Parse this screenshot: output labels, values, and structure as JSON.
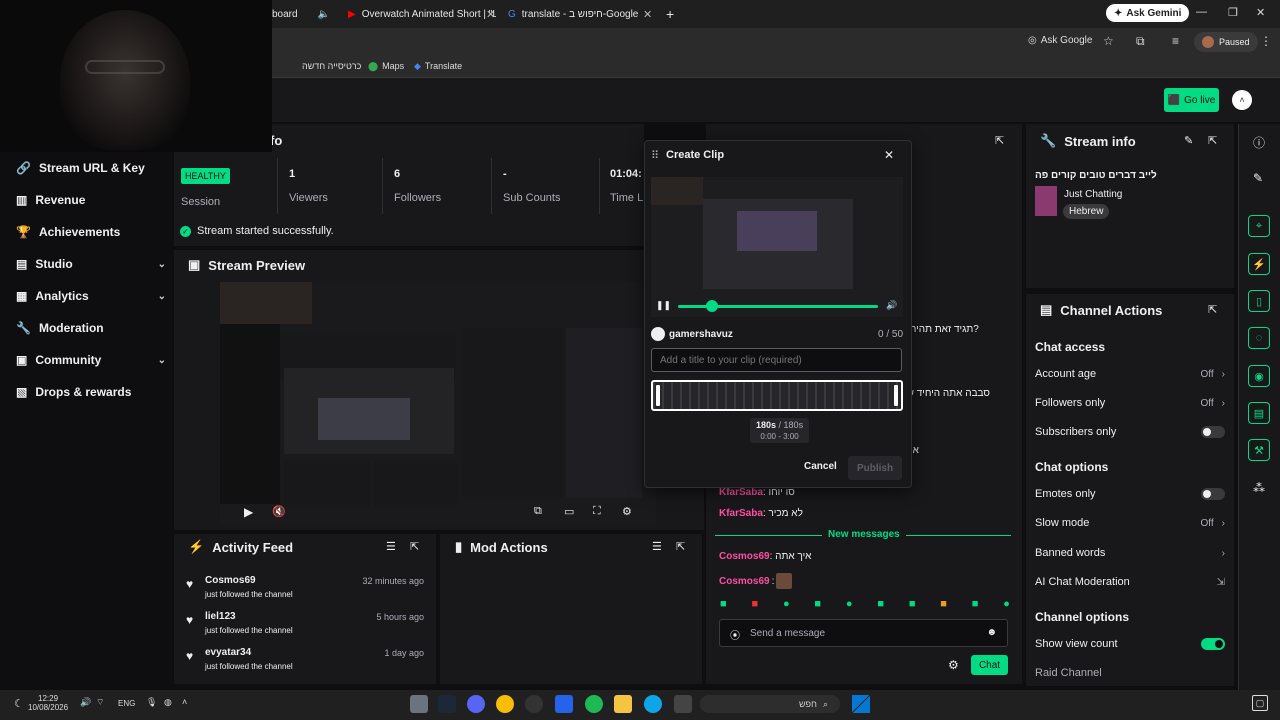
{
  "browser": {
    "tabs": [
      {
        "label": "board"
      },
      {
        "label": "Overwatch Animated Short | \"L"
      },
      {
        "label": "translate - חיפוש ב-Google"
      }
    ],
    "ask_gemini": "Ask Gemini",
    "ask_google": "Ask Google",
    "paused": "Paused",
    "bookmarks": [
      "כרטיסייה חדשה",
      "Maps",
      "Translate"
    ]
  },
  "topnav": {
    "go_live": "Go live"
  },
  "sidebar": {
    "items": [
      {
        "label": "Stream URL & Key",
        "icon": "link-icon"
      },
      {
        "label": "Revenue",
        "icon": "chart-icon"
      },
      {
        "label": "Achievements",
        "icon": "trophy-icon"
      },
      {
        "label": "Studio",
        "icon": "studio-icon",
        "chevron": true
      },
      {
        "label": "Analytics",
        "icon": "analytics-icon",
        "chevron": true
      },
      {
        "label": "Moderation",
        "icon": "wrench-icon"
      },
      {
        "label": "Community",
        "icon": "community-icon",
        "chevron": true
      },
      {
        "label": "Drops & rewards",
        "icon": "drops-icon"
      }
    ]
  },
  "session": {
    "title_fragment": "fo",
    "health_badge": "HEALTHY",
    "session_label": "Session",
    "stats": [
      {
        "value": "1",
        "label": "Viewers"
      },
      {
        "value": "6",
        "label": "Followers"
      },
      {
        "value": "-",
        "label": "Sub Counts"
      },
      {
        "value": "01:04:",
        "label": "Time L"
      }
    ],
    "success_msg": "Stream started successfully."
  },
  "stream_preview": {
    "title": "Stream Preview"
  },
  "activity_feed": {
    "title": "Activity Feed",
    "items": [
      {
        "user": "Cosmos69",
        "action": "just followed the channel",
        "time": "32 minutes ago"
      },
      {
        "user": "liel123",
        "action": "just followed the channel",
        "time": "5 hours ago"
      },
      {
        "user": "evyatar34",
        "action": "just followed the channel",
        "time": "1 day ago"
      }
    ]
  },
  "mod_actions": {
    "title": "Mod Actions"
  },
  "clip_dialog": {
    "title": "Create Clip",
    "username": "gamershavuz",
    "counter": "0 / 50",
    "placeholder": "Add a title to your clip (required)",
    "duration": "180s",
    "duration_total": "/ 180s",
    "range": "0:00 - 3:00",
    "cancel": "Cancel",
    "publish": "Publish",
    "progress": 0.17
  },
  "chat": {
    "partial_lines": [
      "?תגיד זאת תהיה",
      "סבבה אתה היחיד ש",
      "או"
    ],
    "lines": [
      {
        "user": "KfarSaba",
        "text": "סו יוחו",
        "color": "#ff4fa3"
      },
      {
        "user": "KfarSaba",
        "text": "לא מכיר",
        "color": "#ff4fa3"
      }
    ],
    "new_messages": "New messages",
    "new_lines": [
      {
        "user": "Cosmos69",
        "text": "איך אתה",
        "color": "#ff4fa3"
      },
      {
        "user": "Cosmos69",
        "text": "",
        "color": "#ff4fa3"
      }
    ],
    "input_placeholder": "Send a message",
    "send": "Chat"
  },
  "stream_info": {
    "title": "Stream info",
    "stream_title": "לייב דברים טובים קורים פה",
    "category": "Just Chatting",
    "tag": "Hebrew"
  },
  "channel_actions": {
    "title": "Channel Actions",
    "chat_access": "Chat access",
    "account_age": "Account age",
    "account_age_val": "Off",
    "followers_only": "Followers only",
    "followers_only_val": "Off",
    "subscribers_only": "Subscribers only",
    "chat_options": "Chat options",
    "emotes_only": "Emotes only",
    "slow_mode": "Slow mode",
    "slow_mode_val": "Off",
    "banned_words": "Banned words",
    "ai_moderation": "AI Chat Moderation",
    "channel_options": "Channel options",
    "show_view_count": "Show view count",
    "raid_channel": "Raid Channel"
  },
  "taskbar": {
    "time": "12:29",
    "date": "10/08/2026",
    "lang": "ENG",
    "search": "חפש"
  },
  "colors": {
    "accent": "#00db84",
    "bg": "#0e0e10",
    "panel": "#18181b",
    "pink": "#ff4fa3"
  }
}
